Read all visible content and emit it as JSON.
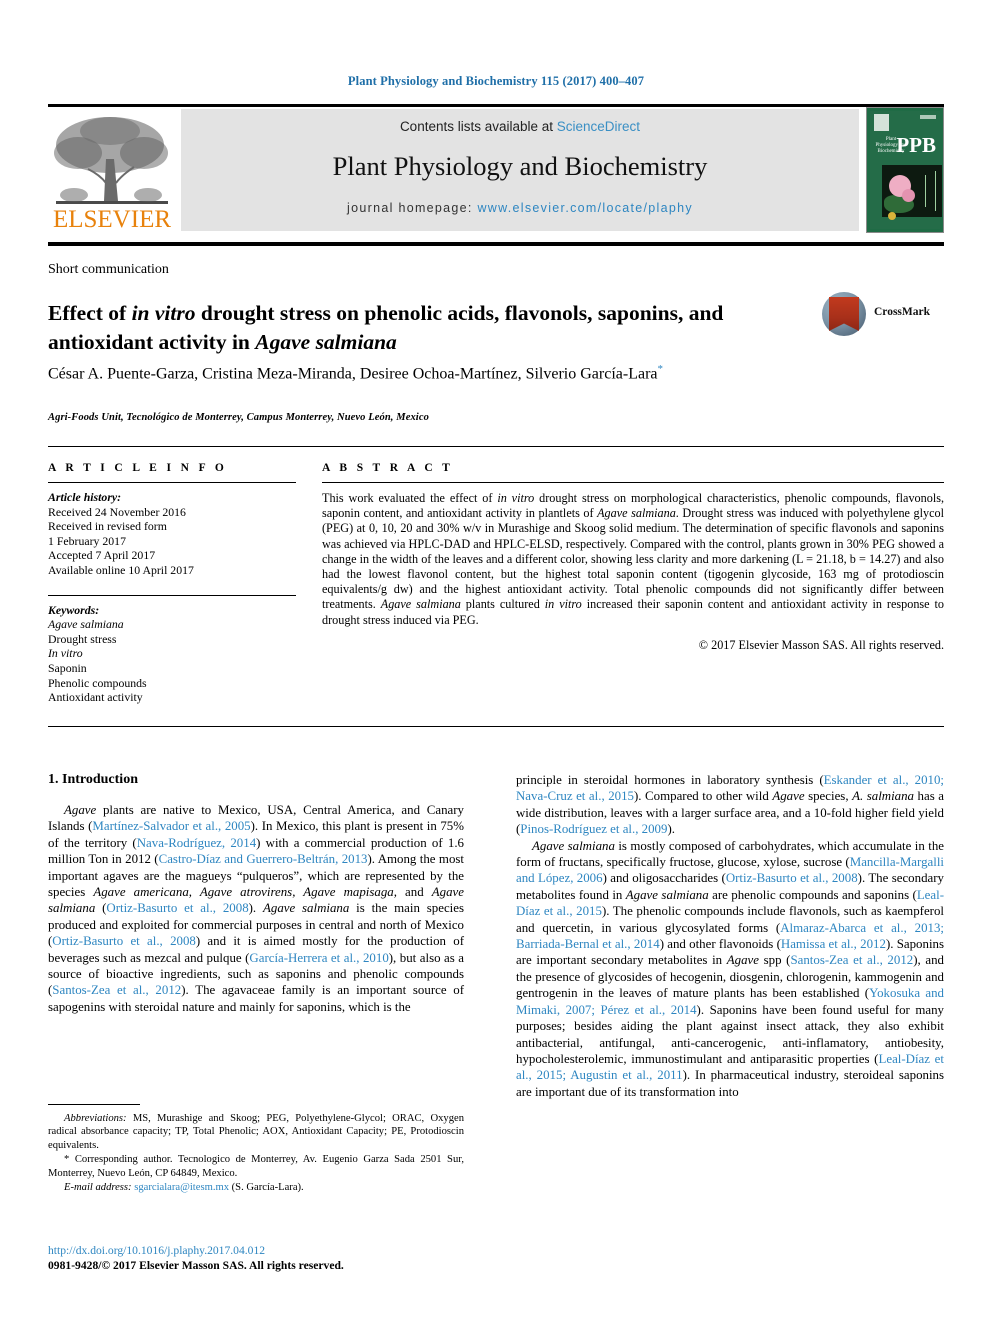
{
  "running_head": "Plant Physiology and Biochemistry 115 (2017) 400–407",
  "masthead": {
    "contents_prefix": "Contents lists available at ",
    "sciencedirect": "ScienceDirect",
    "journal_name": "Plant Physiology and Biochemistry",
    "homepage_label": "journal homepage: ",
    "homepage_url": "www.elsevier.com/locate/plaphy",
    "publisher_logo_text": "ELSEVIER",
    "cover": {
      "abbrev": "PPB",
      "title_lines": "Plant Physiology and Biochemistry"
    },
    "accent_link_color": "#2e86c1",
    "panel_color": "#e3e3e3",
    "cover_color": "#246c48"
  },
  "article": {
    "type": "Short communication",
    "title_part1": "Effect of ",
    "title_italic1": "in vitro",
    "title_part2": " drought stress on phenolic acids, flavonols, saponins, and antioxidant activity in ",
    "title_italic2": "Agave salmiana",
    "authors": "César A. Puente-Garza, Cristina Meza-Miranda, Desiree Ochoa-Martínez, Silverio García-Lara",
    "corresponding_marker": "*",
    "affiliation": "Agri-Foods Unit, Tecnológico de Monterrey, Campus Monterrey, Nuevo León, Mexico",
    "crossmark_label": "CrossMark"
  },
  "article_info": {
    "heading": "A R T I C L E   I N F O",
    "history_label": "Article history:",
    "history": [
      "Received 24 November 2016",
      "Received in revised form",
      "1 February 2017",
      "Accepted 7 April 2017",
      "Available online 10 April 2017"
    ],
    "keywords_label": "Keywords:",
    "keywords": [
      "Agave salmiana",
      "Drought stress",
      "In vitro",
      "Saponin",
      "Phenolic compounds",
      "Antioxidant activity"
    ]
  },
  "abstract": {
    "heading": "A B S T R A C T",
    "p1a": "This work evaluated the effect of ",
    "p1_it1": "in vitro",
    "p1b": " drought stress on morphological characteristics, phenolic compounds, flavonols, saponin content, and antioxidant activity in plantlets of ",
    "p1_it2": "Agave salmiana",
    "p1c": ". Drought stress was induced with polyethylene glycol (PEG) at 0, 10, 20 and 30% w/v in Murashige and Skoog solid medium. The determination of specific flavonols and saponins was achieved via HPLC-DAD and HPLC-ELSD, respectively. Compared with the control, plants grown in 30% PEG showed a change in the width of the leaves and a different color, showing less clarity and more darkening (L = 21.18, b = 14.27) and also had the lowest flavonol content, but the highest total saponin content (tigogenin glycoside, 163 mg of protodioscin equivalents/g dw) and the highest antioxidant activity. Total phenolic compounds did not significantly differ between treatments. ",
    "p1_it3": "Agave salmiana",
    "p1d": " plants cultured ",
    "p1_it4": "in vitro",
    "p1e": " increased their saponin content and antioxidant activity in response to drought stress induced via PEG.",
    "rights": "© 2017 Elsevier Masson SAS. All rights reserved."
  },
  "introduction": {
    "heading": "1. Introduction",
    "left": {
      "p1_a": "Agave",
      "p1_b": " plants are native to Mexico, USA, Central America, and Canary Islands (",
      "p1_r1": "Martínez-Salvador et al., 2005",
      "p1_c": "). In Mexico, this plant is present in 75% of the territory (",
      "p1_r2": "Nava-Rodríguez, 2014",
      "p1_d": ") with a commercial production of 1.6 million Ton in 2012 (",
      "p1_r3": "Castro-Díaz and Guerrero-Beltrán, 2013",
      "p1_e": "). Among the most important agaves are the magueys “pulqueros”, which are represented by the species ",
      "p1_it1": "Agave americana, Agave atrovirens, Agave mapisaga,",
      "p1_f": " and ",
      "p1_it2": "Agave salmiana",
      "p1_g": " (",
      "p1_r4": "Ortiz-Basurto et al., 2008",
      "p1_h": "). ",
      "p1_it3": "Agave salmiana",
      "p1_i": " is the main species produced and exploited for commercial purposes in central and north of Mexico (",
      "p1_r5": "Ortiz-Basurto et al., 2008",
      "p1_j": ") and it is aimed mostly for the production of beverages such as mezcal and pulque (",
      "p1_r6": "García-Herrera et al., 2010",
      "p1_k": "), but also as a source of bioactive ingredients, such as saponins and phenolic compounds (",
      "p1_r7": "Santos-Zea et al., 2012",
      "p1_l": "). The agavaceae family is an important source of sapogenins with steroidal nature and mainly for saponins, which is the"
    },
    "right": {
      "p1_a": "principle in steroidal hormones in laboratory synthesis (",
      "p1_r1": "Eskander et al., 2010; Nava-Cruz et al., 2015",
      "p1_b": "). Compared to other wild ",
      "p1_it1": "Agave",
      "p1_c": " species, ",
      "p1_it2": "A. salmiana",
      "p1_d": " has a wide distribution, leaves with a larger surface area, and a 10-fold higher field yield (",
      "p1_r2": "Pinos-Rodríguez et al., 2009",
      "p1_e": ").",
      "p2_it1": "Agave salmiana",
      "p2_a": " is mostly composed of carbohydrates, which accumulate in the form of fructans, specifically fructose, glucose, xylose, sucrose (",
      "p2_r1": "Mancilla-Margalli and López, 2006",
      "p2_b": ") and oligosaccharides (",
      "p2_r2": "Ortiz-Basurto et al., 2008",
      "p2_c": "). The secondary metabolites found in ",
      "p2_it2": "Agave salmiana",
      "p2_d": " are phenolic compounds and saponins (",
      "p2_r3": "Leal-Díaz et al., 2015",
      "p2_e": "). The phenolic compounds include flavonols, such as kaempferol and quercetin, in various glycosylated forms (",
      "p2_r4": "Almaraz-Abarca et al., 2013; Barriada-Bernal et al., 2014",
      "p2_f": ") and other flavonoids (",
      "p2_r5": "Hamissa et al., 2012",
      "p2_g": "). Saponins are important secondary metabolites in ",
      "p2_it3": "Agave",
      "p2_h": " spp (",
      "p2_r6": "Santos-Zea et al., 2012",
      "p2_i": "), and the presence of glycosides of hecogenin, diosgenin, chlorogenin, kammogenin and gentrogenin in the leaves of mature plants has been established (",
      "p2_r7": "Yokosuka and Mimaki, 2007; Pérez et al., 2014",
      "p2_j": "). Saponins have been found useful for many purposes; besides aiding the plant against insect attack, they also exhibit antibacterial, antifungal, anti-cancerogenic, anti-inflamatory, antiobesity, hypocholesterolemic, immunostimulant and antiparasitic properties (",
      "p2_r8": "Leal-Díaz et al., 2015; Augustin et al., 2011",
      "p2_k": "). In pharmaceutical industry, steroideal saponins are important due of its transformation into"
    }
  },
  "footnotes": {
    "abbrev_label": "Abbreviations:",
    "abbrev_text": " MS, Murashige and Skoog; PEG, Polyethylene-Glycol; ORAC, Oxygen radical absorbance capacity; TP, Total Phenolic; AOX, Antioxidant Capacity; PE, Protodioscin equivalents.",
    "corresponding": "* Corresponding author. Tecnologico de Monterrey, Av. Eugenio Garza Sada 2501 Sur, Monterrey, Nuevo León, CP 64849, Mexico.",
    "email_label": "E-mail address:",
    "email": "sgarcialara@itesm.mx",
    "email_suffix": " (S. García-Lara)."
  },
  "footer": {
    "doi": "http://dx.doi.org/10.1016/j.plaphy.2017.04.012",
    "issn_copyright": "0981-9428/© 2017 Elsevier Masson SAS. All rights reserved."
  }
}
